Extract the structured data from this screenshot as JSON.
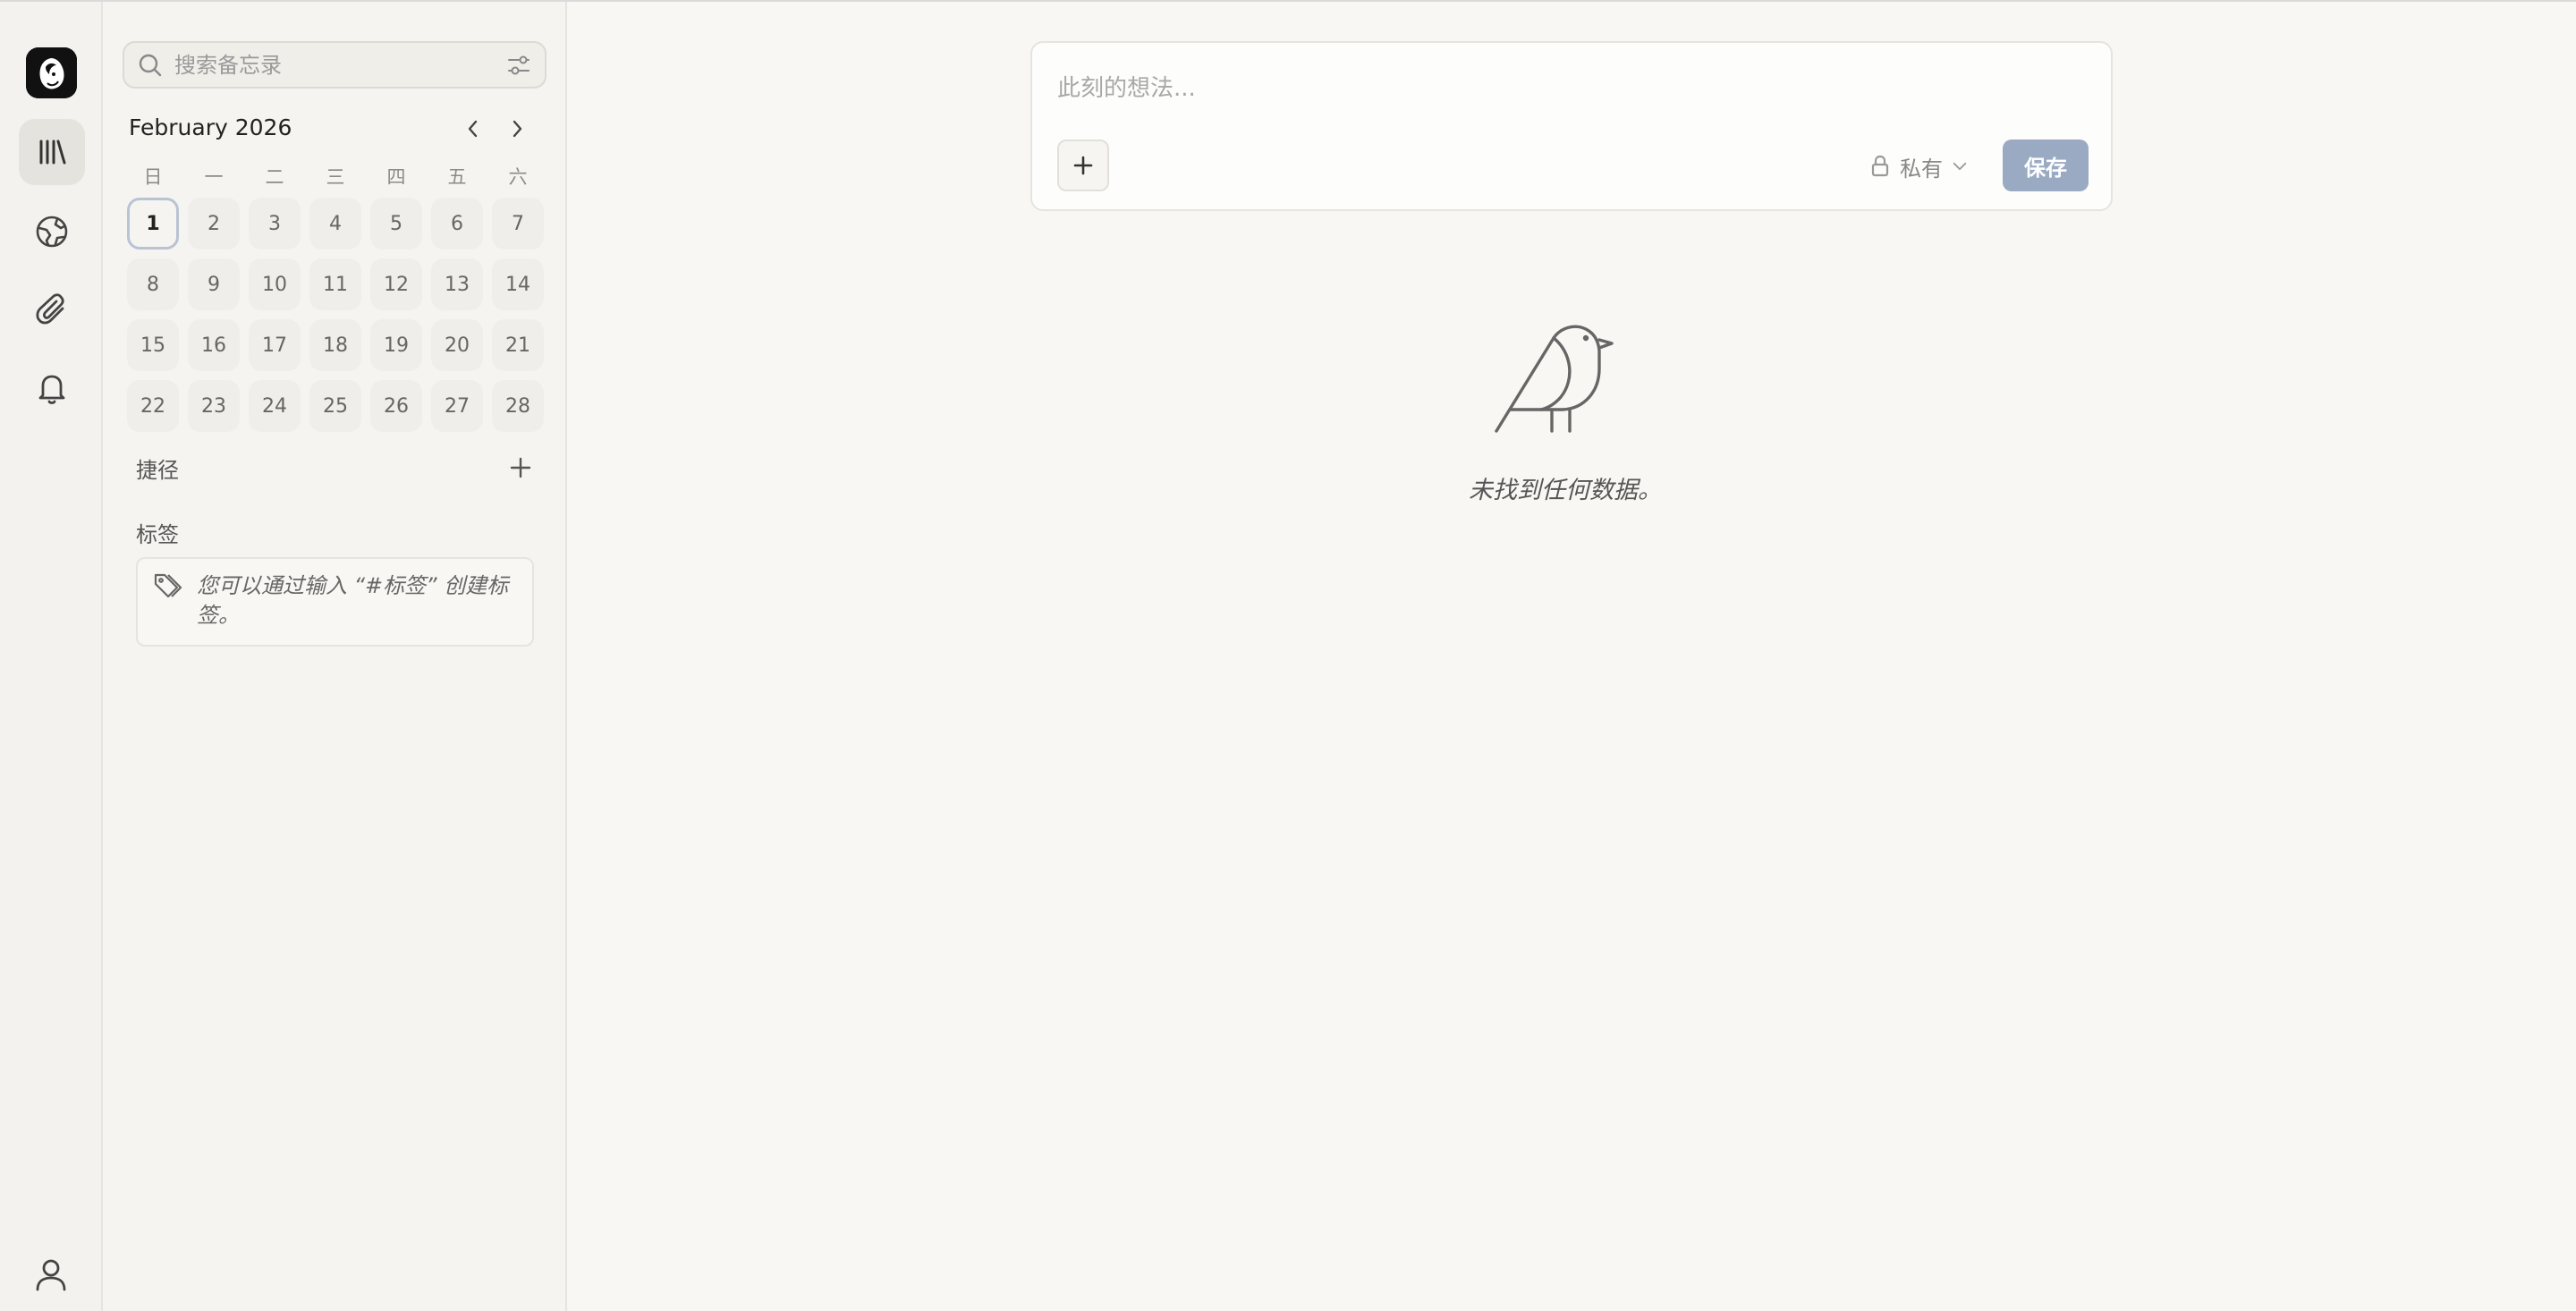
{
  "rail": {
    "items": [
      {
        "name": "memos",
        "icon": "library-icon",
        "active": true
      },
      {
        "name": "explore",
        "icon": "globe-icon",
        "active": false
      },
      {
        "name": "attachments",
        "icon": "paperclip-icon",
        "active": false
      },
      {
        "name": "notifications",
        "icon": "bell-icon",
        "active": false
      }
    ],
    "user_icon": "user-icon"
  },
  "search": {
    "placeholder": "搜索备忘录"
  },
  "calendar": {
    "month_label": "February 2026",
    "weekdays": [
      "日",
      "一",
      "二",
      "三",
      "四",
      "五",
      "六"
    ],
    "days": [
      "1",
      "2",
      "3",
      "4",
      "5",
      "6",
      "7",
      "8",
      "9",
      "10",
      "11",
      "12",
      "13",
      "14",
      "15",
      "16",
      "17",
      "18",
      "19",
      "20",
      "21",
      "22",
      "23",
      "24",
      "25",
      "26",
      "27",
      "28"
    ],
    "today": "1"
  },
  "shortcuts": {
    "label": "捷径"
  },
  "tags": {
    "label": "标签",
    "hint": "您可以通过输入 “#标签” 创建标签。"
  },
  "editor": {
    "placeholder": "此刻的想法...",
    "visibility": "私有",
    "save_label": "保存"
  },
  "empty_state": {
    "message": "未找到任何数据。"
  },
  "colors": {
    "accent": "#9aaac3",
    "background": "#f8f7f4"
  }
}
